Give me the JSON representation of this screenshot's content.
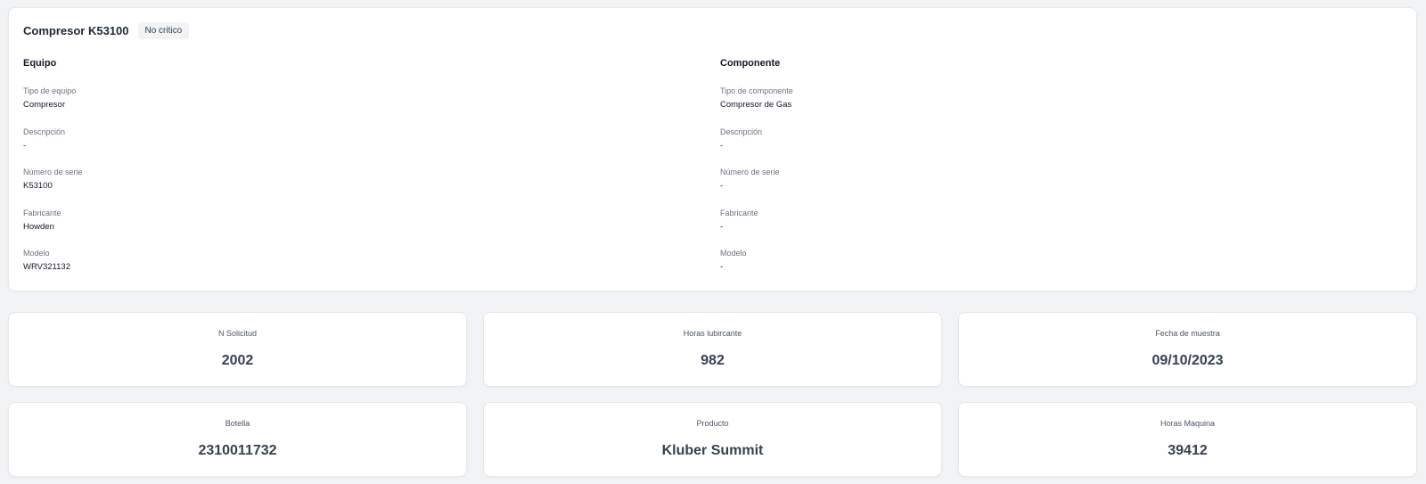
{
  "header": {
    "title": "Compresor K53100",
    "badge": "No critico"
  },
  "equipo": {
    "heading": "Equipo",
    "fields": [
      {
        "label": "Tipo de equipo",
        "value": "Compresor"
      },
      {
        "label": "Descripción",
        "value": "-"
      },
      {
        "label": "Número de serie",
        "value": "K53100"
      },
      {
        "label": "Fabricante",
        "value": "Howden"
      },
      {
        "label": "Modelo",
        "value": "WRV321132"
      }
    ]
  },
  "componente": {
    "heading": "Componente",
    "fields": [
      {
        "label": "Tipo de componente",
        "value": "Compresor de Gas"
      },
      {
        "label": "Descripción",
        "value": "-"
      },
      {
        "label": "Número de serie",
        "value": "-"
      },
      {
        "label": "Fabricante",
        "value": "-"
      },
      {
        "label": "Modelo",
        "value": "-"
      }
    ]
  },
  "stats": [
    {
      "label": "N Solicitud",
      "value": "2002"
    },
    {
      "label": "Horas lubircante",
      "value": "982"
    },
    {
      "label": "Fecha de muestra",
      "value": "09/10/2023"
    },
    {
      "label": "Botella",
      "value": "2310011732"
    },
    {
      "label": "Producto",
      "value": "Kluber Summit"
    },
    {
      "label": "Horas Maquina",
      "value": "39412"
    }
  ]
}
